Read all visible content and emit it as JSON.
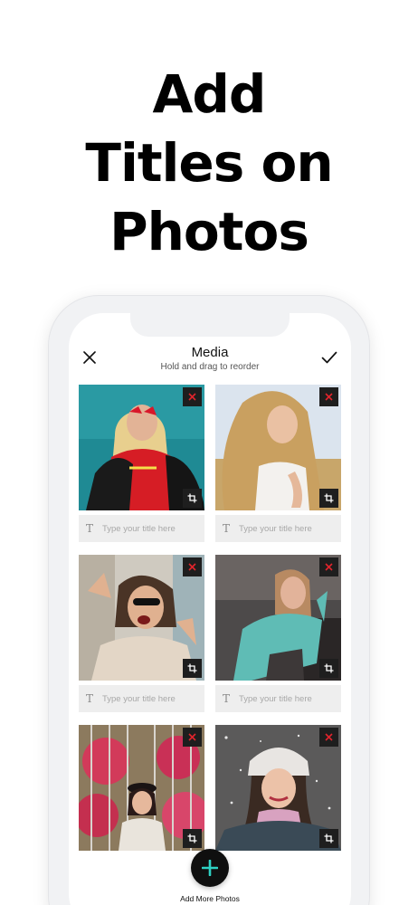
{
  "promo": {
    "headline_lines": [
      "Add",
      "Titles on",
      "Photos"
    ]
  },
  "header": {
    "title": "Media",
    "subtitle": "Hold and drag to reorder",
    "close_icon": "close-icon",
    "confirm_icon": "checkmark-icon"
  },
  "photos": [
    {
      "title_placeholder": "Type your title here",
      "delete_icon": "delete-icon",
      "crop_icon": "crop-icon"
    },
    {
      "title_placeholder": "Type your title here",
      "delete_icon": "delete-icon",
      "crop_icon": "crop-icon"
    },
    {
      "title_placeholder": "Type your title here",
      "delete_icon": "delete-icon",
      "crop_icon": "crop-icon"
    },
    {
      "title_placeholder": "Type your title here",
      "delete_icon": "delete-icon",
      "crop_icon": "crop-icon"
    },
    {
      "title_placeholder": "",
      "delete_icon": "delete-icon",
      "crop_icon": "crop-icon"
    },
    {
      "title_placeholder": "",
      "delete_icon": "delete-icon",
      "crop_icon": "crop-icon"
    }
  ],
  "add_button": {
    "label": "Add More Photos",
    "icon": "plus-icon"
  },
  "colors": {
    "accent": "#2ed1c4",
    "delete_x": "#e0242c",
    "button_bg": "#1e1e1e"
  }
}
